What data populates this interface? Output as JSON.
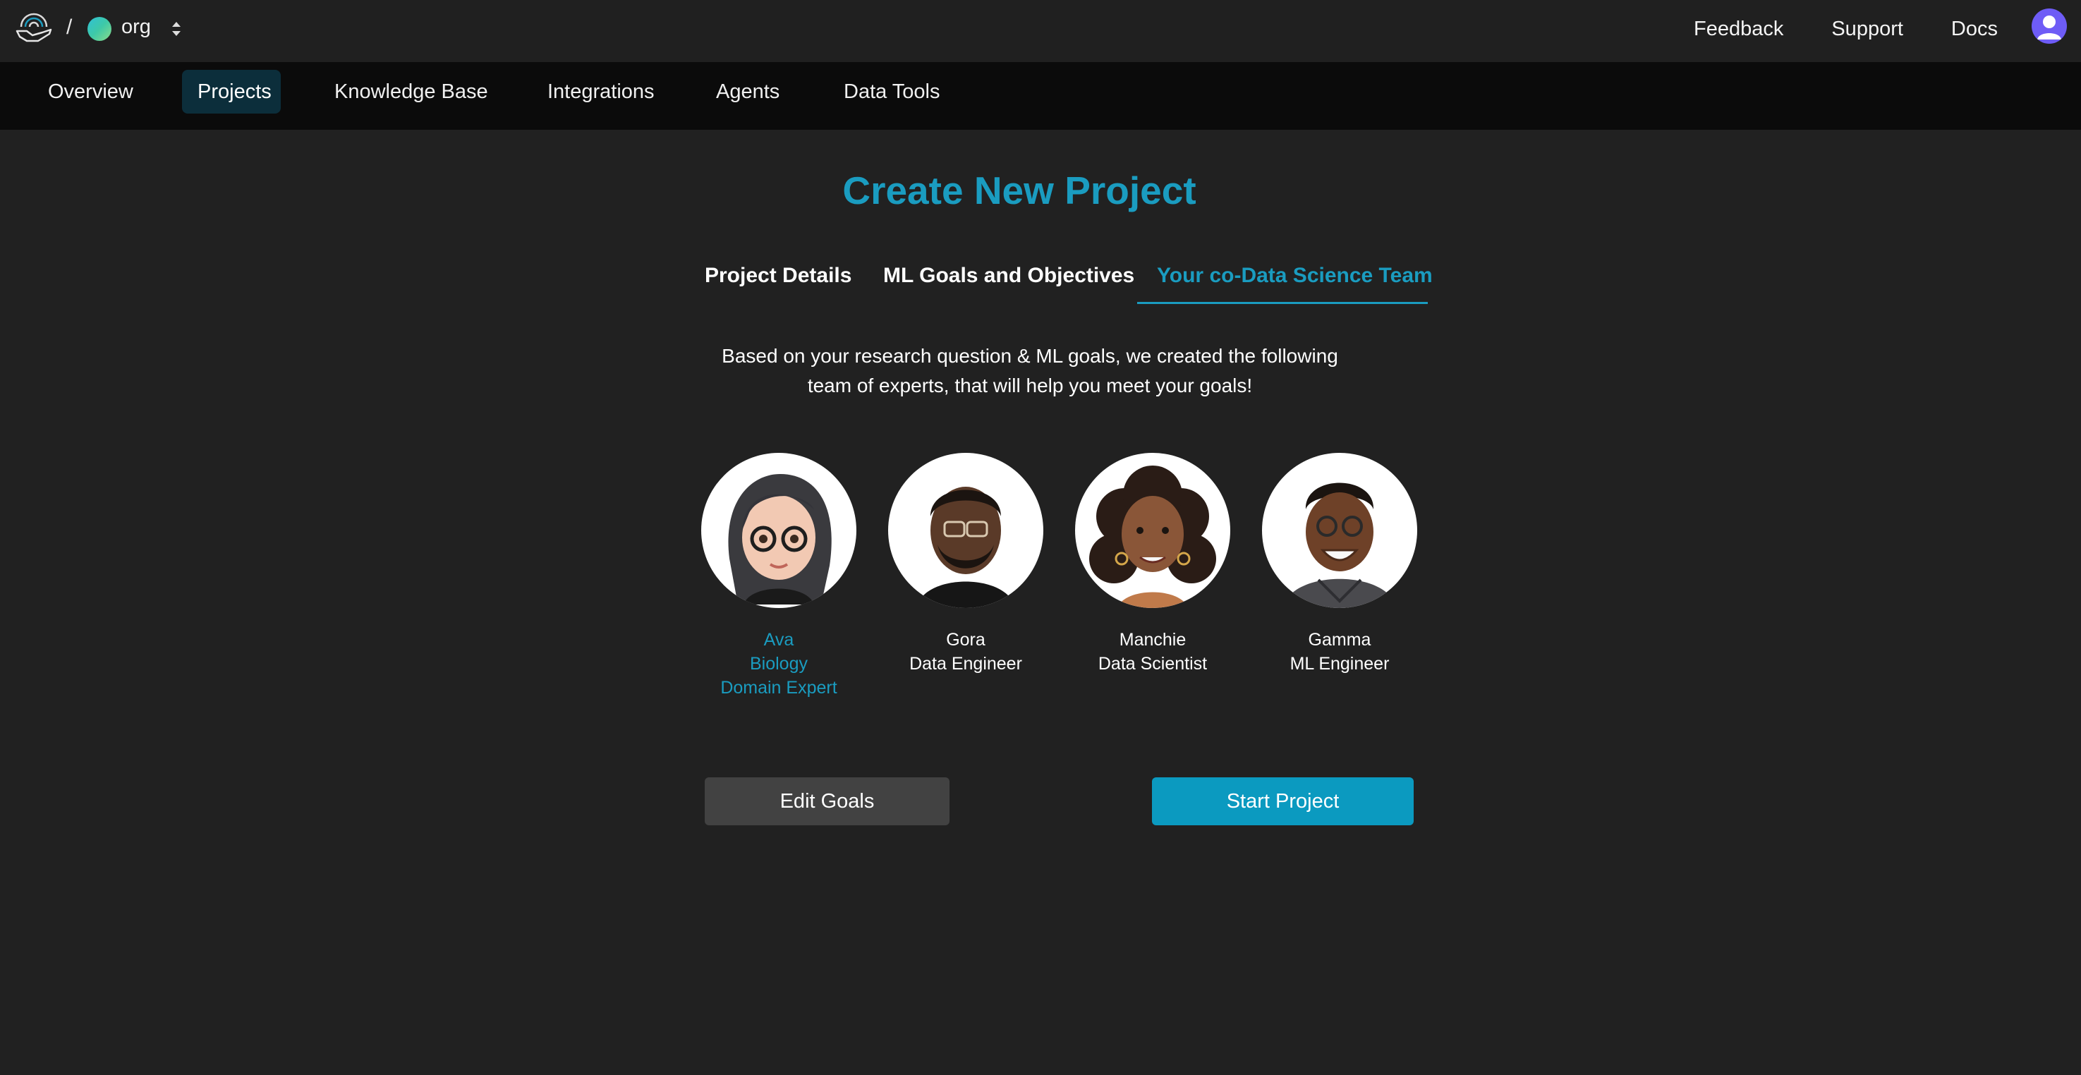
{
  "topbar": {
    "breadcrumb_separator": "/",
    "org_name": "org",
    "links": [
      "Feedback",
      "Support",
      "Docs"
    ],
    "icons": {
      "logo": "brain-hand-logo",
      "org_switch": "chevron-updown-icon",
      "user": "user-avatar-icon"
    },
    "org_dot_color": "#3ec9a7",
    "avatar_color": "#6e5cf6"
  },
  "nav": {
    "items": [
      "Overview",
      "Projects",
      "Knowledge Base",
      "Integrations",
      "Agents",
      "Data Tools"
    ],
    "active": "Projects"
  },
  "main": {
    "title": "Create New Project",
    "tabs": [
      "Project Details",
      "ML Goals and Objectives",
      "Your co-Data Science Team"
    ],
    "active_tab": "Your co-Data Science Team",
    "intro_line1": "Based on your research question & ML goals, we created the following",
    "intro_line2": "team of experts, that will help you meet your goals!",
    "team": [
      {
        "name": "Ava",
        "line2": "Biology",
        "line3": "Domain Expert",
        "selected": true
      },
      {
        "name": "Gora",
        "line2": "Data Engineer",
        "line3": ""
      },
      {
        "name": "Manchie",
        "line2": "Data Scientist",
        "line3": ""
      },
      {
        "name": "Gamma",
        "line2": "ML Engineer",
        "line3": ""
      }
    ],
    "buttons": {
      "edit": "Edit Goals",
      "start": "Start Project"
    }
  },
  "colors": {
    "accent": "#1a9cc0",
    "background": "#212121",
    "nav_background": "#0b0b0b",
    "active_nav": "#0c2e3b",
    "start_button": "#0b9ac0",
    "edit_button": "#424242"
  }
}
